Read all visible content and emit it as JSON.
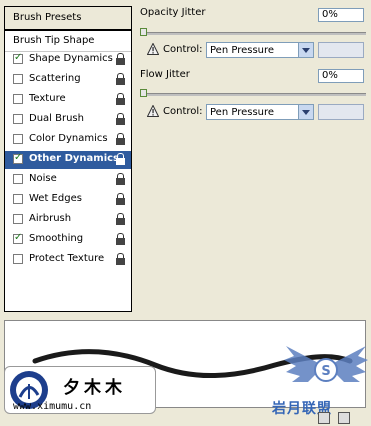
{
  "brush_presets_label": "Brush Presets",
  "brush_tip_shape_label": "Brush Tip Shape",
  "options": [
    {
      "label": "Shape Dynamics",
      "checked": true
    },
    {
      "label": "Scattering",
      "checked": false
    },
    {
      "label": "Texture",
      "checked": false
    },
    {
      "label": "Dual Brush",
      "checked": false
    },
    {
      "label": "Color Dynamics",
      "checked": false
    },
    {
      "label": "Other Dynamics",
      "checked": true,
      "selected": true
    },
    {
      "label": "Noise",
      "checked": false
    },
    {
      "label": "Wet Edges",
      "checked": false
    },
    {
      "label": "Airbrush",
      "checked": false
    },
    {
      "label": "Smoothing",
      "checked": true
    },
    {
      "label": "Protect Texture",
      "checked": false
    }
  ],
  "opacity": {
    "label": "Opacity Jitter",
    "value": "0%",
    "control_label": "Control:",
    "control_value": "Pen Pressure",
    "slider_fraction": 0
  },
  "flow": {
    "label": "Flow Jitter",
    "value": "0%",
    "control_label": "Control:",
    "control_value": "Pen Pressure",
    "slider_fraction": 0
  },
  "watermark": {
    "chinese_name": "夕木木",
    "url": "www.ximumu.cn",
    "site_text": "岩月联盟"
  },
  "colors": {
    "selected_row": "#2f5b9e",
    "checkmark": "#1e7a1e",
    "panel_bg": "#ece9d8"
  }
}
